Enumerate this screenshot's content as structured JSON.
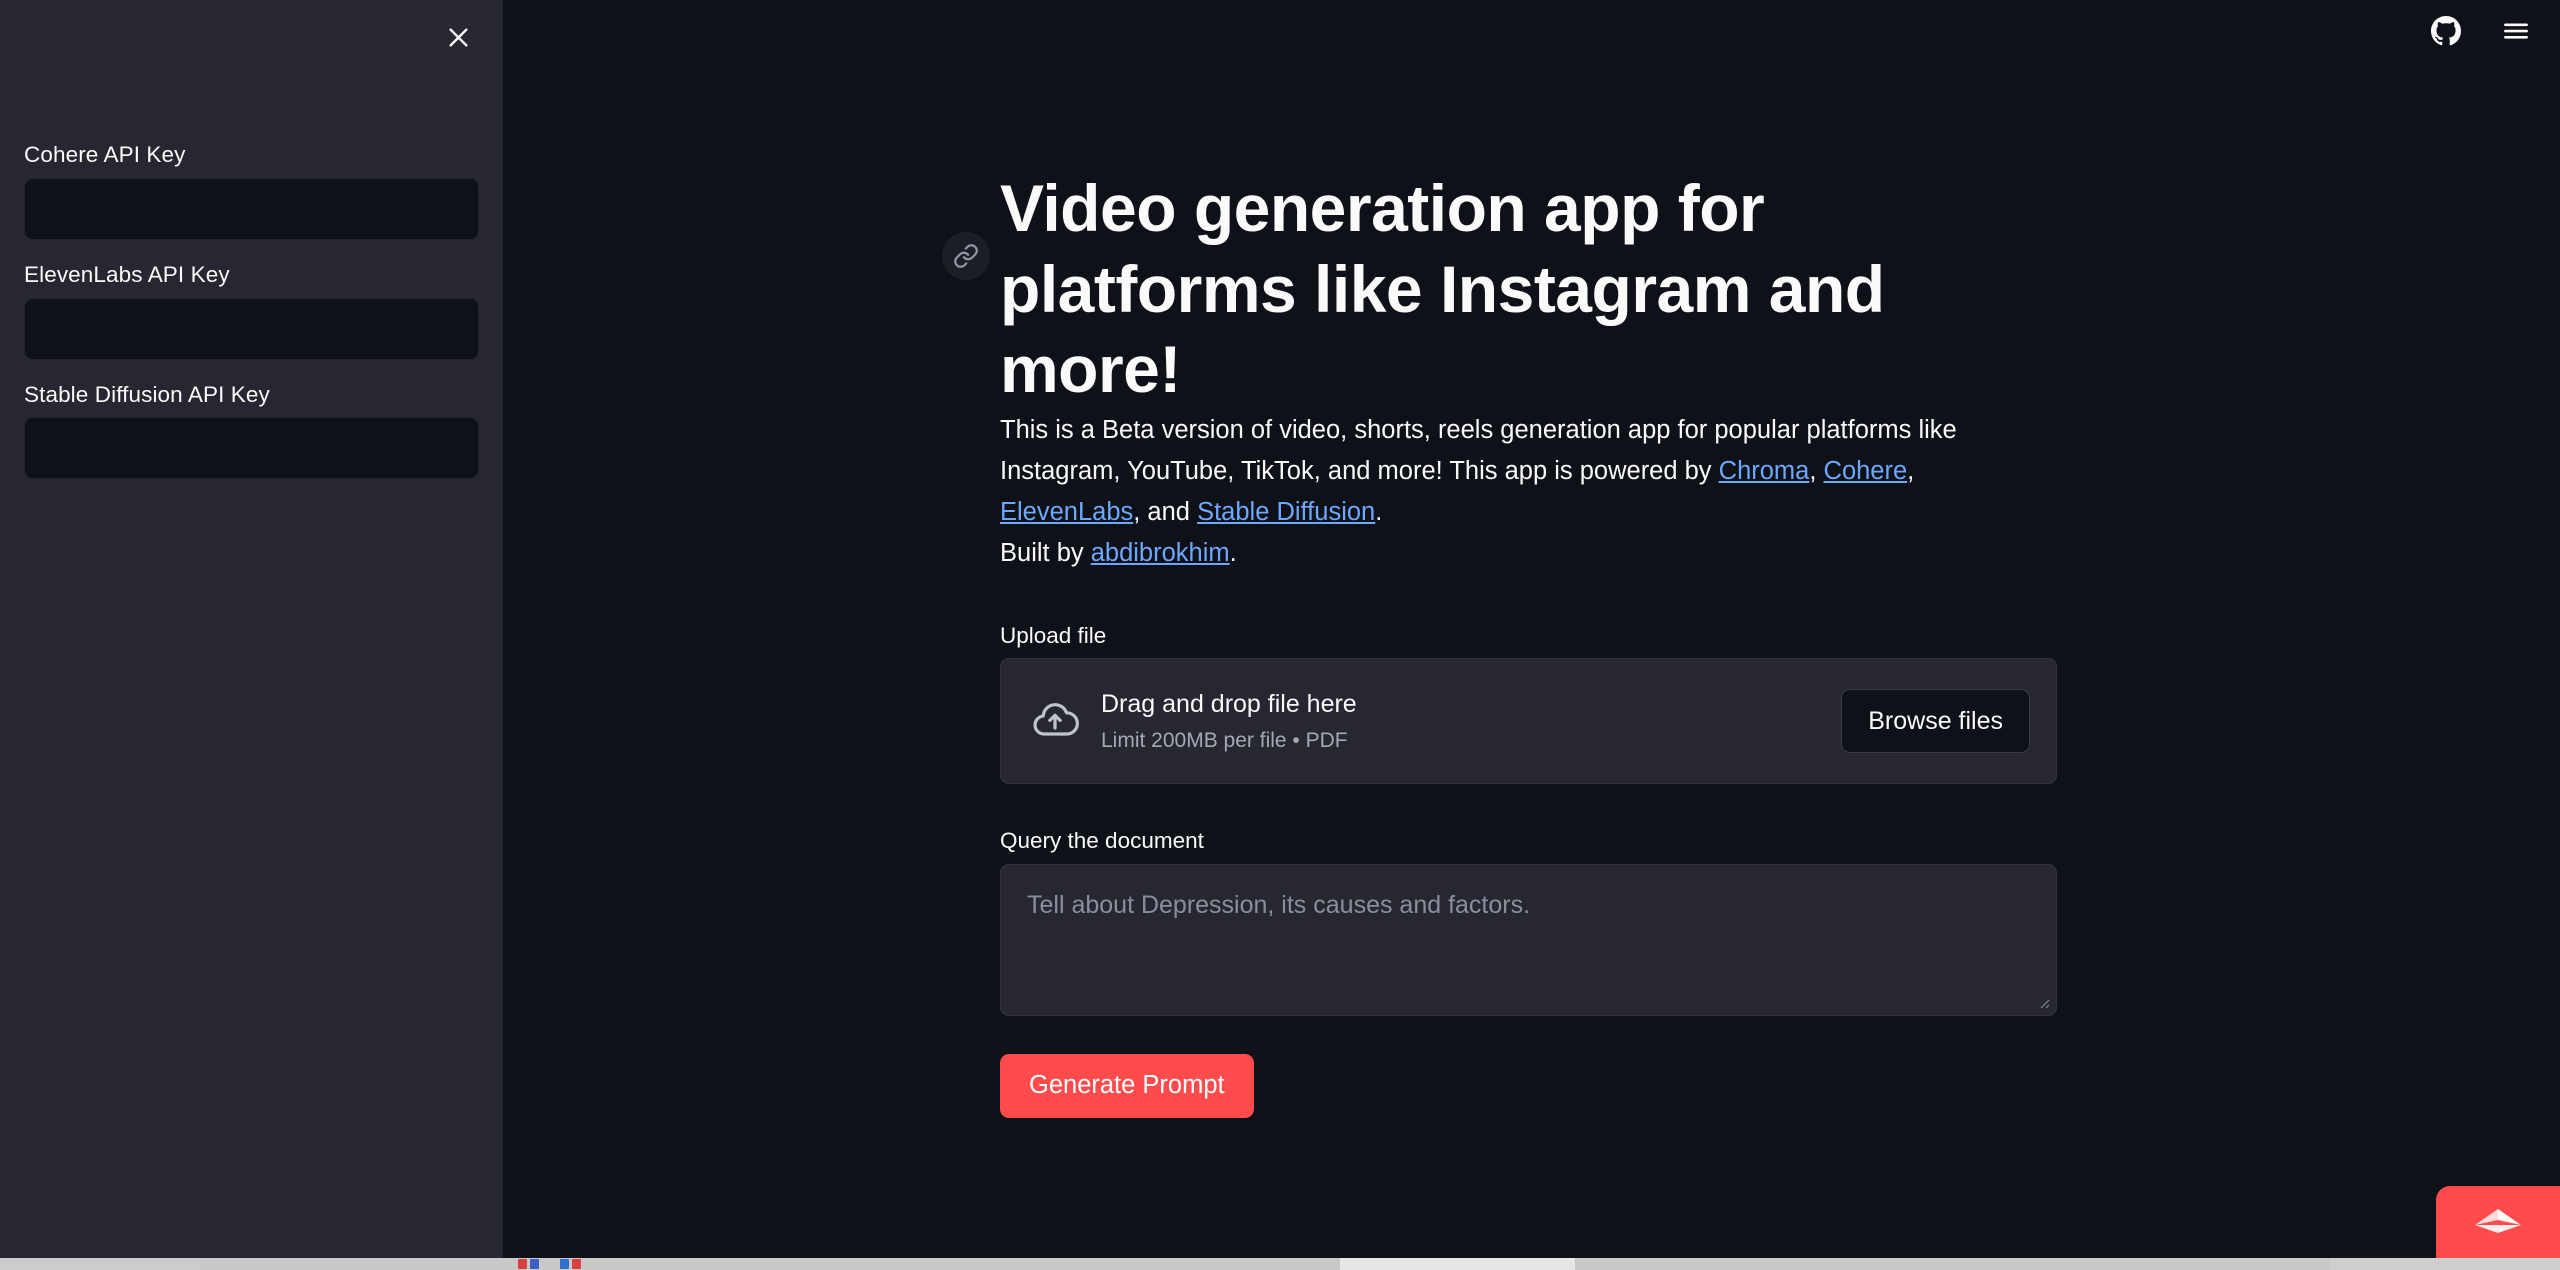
{
  "theme": {
    "bg": "#0E1117",
    "sidebar_bg": "#262730",
    "widget_bg": "#262730",
    "text": "#FAFAFA",
    "link": "#6EA8FE",
    "primary": "#FF4B4B"
  },
  "sidebar": {
    "close_label": "×",
    "fields": [
      {
        "label": "Cohere API Key",
        "value": "",
        "placeholder": ""
      },
      {
        "label": "ElevenLabs API Key",
        "value": "",
        "placeholder": ""
      },
      {
        "label": "Stable Diffusion API Key",
        "value": "",
        "placeholder": ""
      }
    ]
  },
  "toolbar": {
    "github_title": "GitHub",
    "menu_title": "Main menu"
  },
  "main": {
    "title": "Video generation app for platforms like Instagram and more!",
    "anchor_title": "Link to this heading",
    "intro": {
      "part1": "This is a Beta version of video, shorts, reels generation app for popular platforms like Instagram, YouTube, TikTok, and more! This app is powered by ",
      "link1": "Chroma",
      "sep1": ", ",
      "link2": "Cohere",
      "sep2": ", ",
      "link3": "ElevenLabs",
      "sep3": ", and ",
      "link4": "Stable Diffusion",
      "end": "."
    },
    "built": {
      "prefix": "Built by ",
      "author": "abdibrokhim",
      "end": "."
    },
    "upload": {
      "label": "Upload file",
      "drag_title": "Drag and drop file here",
      "limit": "Limit 200MB per file • PDF",
      "browse_label": "Browse files"
    },
    "query": {
      "label": "Query the document",
      "value": "",
      "placeholder": "Tell about Depression, its causes and factors."
    },
    "generate_label": "Generate Prompt"
  },
  "deploy_badge": {
    "title": "Manage app"
  }
}
